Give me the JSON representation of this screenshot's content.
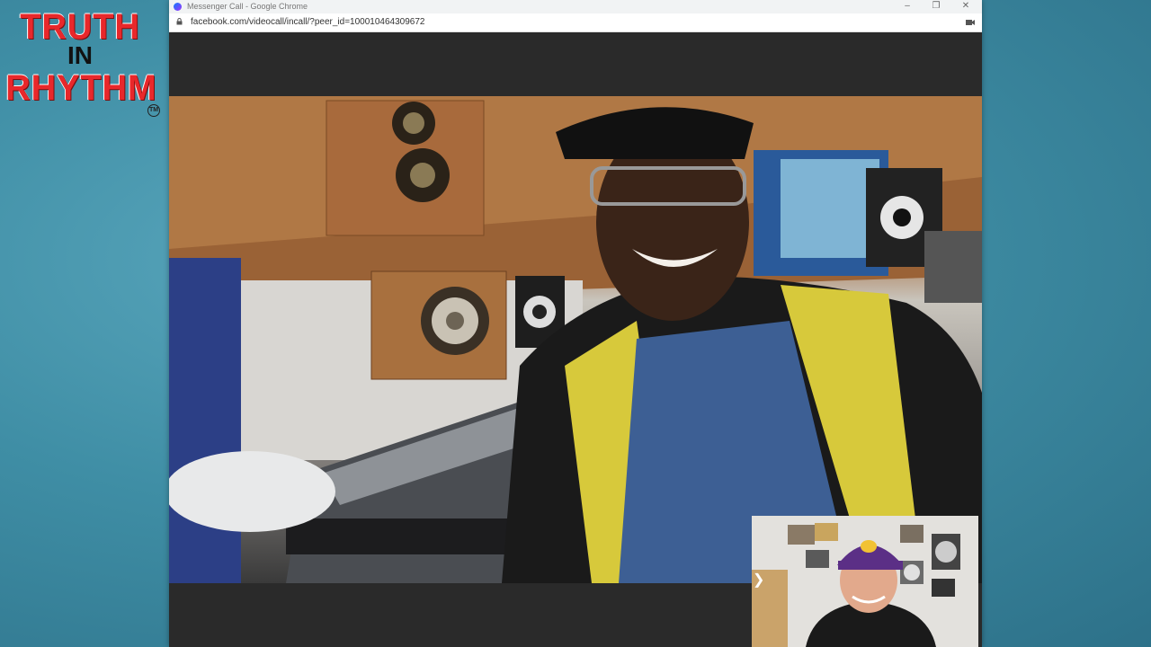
{
  "logo": {
    "line1": "TRUTH",
    "line2": "IN",
    "line3": "RHYTHM",
    "trademark": "TM"
  },
  "browser": {
    "title": "Messenger Call - Google Chrome",
    "url": "facebook.com/videocall/incall/?peer_id=100010464309672",
    "controls": {
      "minimize": "–",
      "restore": "❐",
      "close": "✕"
    }
  },
  "call": {
    "pip_toggle": "❯",
    "icons": {
      "favicon": "messenger-icon",
      "lock": "lock-icon",
      "camera": "camera-icon"
    }
  },
  "colors": {
    "logo_red": "#e8282b",
    "background_teal": "#3f8ea5",
    "chrome_bar": "#f1f3f4"
  }
}
